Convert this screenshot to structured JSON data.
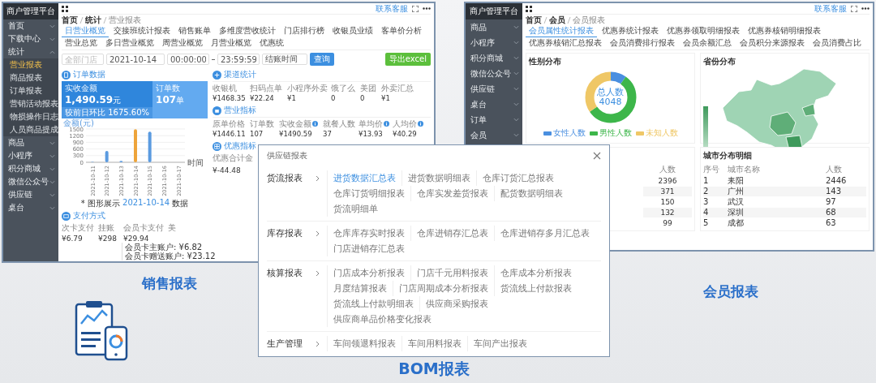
{
  "sales_screen": {
    "brand": "商户管理平台",
    "sidebar": {
      "items": [
        {
          "label": "首页",
          "expanded": false
        },
        {
          "label": "下载中心",
          "expanded": false
        },
        {
          "label": "统计",
          "expanded": true,
          "children": [
            {
              "label": "营业报表",
              "selected": true
            },
            {
              "label": "商品报表",
              "selected": false
            },
            {
              "label": "订单报表",
              "selected": false
            },
            {
              "label": "营销活动报表",
              "selected": false
            },
            {
              "label": "物损操作日志",
              "selected": false
            },
            {
              "label": "人员商品提成",
              "selected": false
            }
          ]
        },
        {
          "label": "商品",
          "expanded": false
        },
        {
          "label": "小程序",
          "expanded": false
        },
        {
          "label": "积分商城",
          "expanded": false
        },
        {
          "label": "微信公众号",
          "expanded": false
        },
        {
          "label": "供应链",
          "expanded": false
        },
        {
          "label": "桌台",
          "expanded": false
        }
      ]
    },
    "support": "联系客服",
    "breadcrumb": [
      "首页",
      "统计",
      "营业报表"
    ],
    "tabs": [
      {
        "label": "日营业概览",
        "selected": true
      },
      {
        "label": "交接班统计报表",
        "selected": false
      },
      {
        "label": "销售账单",
        "selected": false
      },
      {
        "label": "多维度营收统计",
        "selected": false
      },
      {
        "label": "门店排行榜",
        "selected": false
      },
      {
        "label": "收银员业绩",
        "selected": false
      },
      {
        "label": "客单价分析",
        "selected": false
      },
      {
        "label": "营业总览",
        "selected": false
      },
      {
        "label": "多日营业概览",
        "selected": false
      },
      {
        "label": "周营业概览",
        "selected": false
      },
      {
        "label": "月营业概览",
        "selected": false
      },
      {
        "label": "优惠统",
        "selected": false
      }
    ],
    "filters": {
      "store": {
        "placeholder": "全部门店"
      },
      "date": "2021-10-14",
      "start_time": "00:00:00",
      "end_time": "23:59:59",
      "time_type": "结账时间",
      "query_button": "查询",
      "export_button": "导出excel"
    },
    "order_data": {
      "title": "订单数据",
      "cards": [
        {
          "label": "实收金额",
          "value": "1,490.59",
          "unit": "元",
          "note": "较前日环比 1675.60%",
          "selected": true
        },
        {
          "label": "订单数",
          "value": "107",
          "unit": "单",
          "selected": false
        }
      ],
      "chart_data": {
        "type": "bar",
        "xlabel": "时间",
        "grid": true,
        "categories": [
          "2021-10-11",
          "2021-10-12",
          "2021-10-13",
          "2021-10-14",
          "2021-10-15",
          "2021-10-16",
          "2021-10-17"
        ],
        "series": [
          {
            "name": "金额(元)",
            "color": "#5b9be0",
            "values": [
              20,
              510,
              60,
              null,
              1380,
              null,
              null
            ]
          },
          {
            "name": "2021-10-14",
            "color": "#eea43a",
            "values": [
              null,
              null,
              null,
              1490,
              null,
              null,
              null
            ]
          }
        ],
        "ylim": [
          0,
          1500
        ],
        "yticks": [
          0,
          300,
          600,
          900,
          1200,
          1500
        ]
      },
      "chart_caption": {
        "prefix": "* 图形展示",
        "suffix": "数据"
      }
    },
    "payment": {
      "title": "支付方式",
      "columns": [
        "次卡支付",
        "挂账",
        "会员卡支付",
        "美"
      ],
      "values": [
        "¥6.79",
        "¥298",
        "¥29.94"
      ],
      "member_card_details": [
        "会员卡主账户: ¥6.82",
        "会员卡赠送账户: ¥23.12"
      ]
    },
    "channel_stats": {
      "title": "渠道统计",
      "columns": [
        "收银机",
        "扫码点单",
        "小程序外卖",
        "饿了么",
        "美团",
        "外卖汇总"
      ],
      "values": [
        "¥1468.35",
        "¥22.24",
        "¥1",
        "0",
        "0",
        "¥1"
      ]
    },
    "business_metrics": {
      "title": "营业指标",
      "columns": [
        {
          "label": "原单价格",
          "info": false
        },
        {
          "label": "订单数",
          "info": false
        },
        {
          "label": "实收金额",
          "info": true
        },
        {
          "label": "就餐人数",
          "info": false
        },
        {
          "label": "单均价",
          "info": true
        },
        {
          "label": "人均价",
          "info": true
        }
      ],
      "values": [
        "¥1446.11",
        "107",
        "¥1490.59",
        "37",
        "¥13.93",
        "¥40.29"
      ]
    },
    "discount_metrics": {
      "title": "优惠指标",
      "columns": [
        "优惠合计金"
      ],
      "values": [
        "¥-44.48"
      ]
    }
  },
  "sales_caption": "销售报表",
  "member_screen": {
    "brand": "商户管理平台",
    "sidebar": {
      "items": [
        {
          "label": "商品",
          "expanded": false
        },
        {
          "label": "小程序",
          "expanded": false
        },
        {
          "label": "积分商城",
          "expanded": false
        },
        {
          "label": "微信公众号",
          "expanded": false
        },
        {
          "label": "供应链",
          "expanded": false
        },
        {
          "label": "桌台",
          "expanded": false
        },
        {
          "label": "订单",
          "expanded": false
        },
        {
          "label": "会员",
          "expanded": false
        }
      ]
    },
    "support": "联系客服",
    "breadcrumb": [
      "首页",
      "会员",
      "会员报表"
    ],
    "tabs": [
      {
        "label": "会员属性统计报表",
        "selected": true
      },
      {
        "label": "优惠券统计报表",
        "selected": false
      },
      {
        "label": "优惠券领取明细报表",
        "selected": false
      },
      {
        "label": "优惠券核销明细报表",
        "selected": false
      },
      {
        "label": "优惠券核销汇总报表",
        "selected": false
      },
      {
        "label": "会员消费排行报表",
        "selected": false
      },
      {
        "label": "会员余额汇总",
        "selected": false
      },
      {
        "label": "会员积分来源报表",
        "selected": false
      },
      {
        "label": "会员消费占比",
        "selected": false
      }
    ],
    "gender": {
      "title": "性别分布",
      "center_label": "总人数",
      "total": "4048",
      "legend": [
        {
          "label": "女性人数",
          "color": "#4a8fe0"
        },
        {
          "label": "男性人数",
          "color": "#3db64a"
        },
        {
          "label": "未知人数",
          "color": "#efc766"
        }
      ]
    },
    "province": {
      "title": "省份分布"
    },
    "level_table": {
      "columns": [
        "人数"
      ],
      "rows": [
        [
          "2396"
        ],
        [
          "371"
        ],
        [
          "150"
        ],
        [
          "132"
        ],
        [
          "99"
        ]
      ]
    },
    "city_table": {
      "title": "城市分布明细",
      "columns": [
        "序号",
        "城市名称",
        "人数"
      ],
      "rows": [
        [
          "1",
          "耒阳",
          "2446"
        ],
        [
          "2",
          "广州",
          "143"
        ],
        [
          "3",
          "武汉",
          "97"
        ],
        [
          "4",
          "深圳",
          "68"
        ],
        [
          "5",
          "成都",
          "63"
        ]
      ]
    }
  },
  "member_caption": "会员报表",
  "supply_popup": {
    "title": "供应链报表",
    "groups": [
      {
        "label": "货流报表",
        "items": [
          {
            "label": "进货数据汇总表",
            "selected": true
          },
          {
            "label": "进货数据明细表",
            "selected": false
          },
          {
            "label": "仓库订货汇总报表",
            "selected": false
          },
          {
            "label": "仓库订货明细报表",
            "selected": false
          },
          {
            "label": "仓库实发差货报表",
            "selected": false
          },
          {
            "label": "配货数据明细表",
            "selected": false
          },
          {
            "label": "货流明细单",
            "selected": false
          }
        ]
      },
      {
        "label": "库存报表",
        "items": [
          {
            "label": "仓库库存实时报表",
            "selected": false
          },
          {
            "label": "仓库进销存汇总表",
            "selected": false
          },
          {
            "label": "仓库进销存多月汇总表",
            "selected": false
          },
          {
            "label": "门店进销存汇总表",
            "selected": false
          }
        ]
      },
      {
        "label": "核算报表",
        "items": [
          {
            "label": "门店成本分析报表",
            "selected": false
          },
          {
            "label": "门店千元用料报表",
            "selected": false
          },
          {
            "label": "仓库成本分析报表",
            "selected": false
          },
          {
            "label": "月度结算报表",
            "selected": false
          },
          {
            "label": "门店周期成本分析报表",
            "selected": false
          },
          {
            "label": "货流线上付款报表",
            "selected": false
          },
          {
            "label": "货流线上付款明细表",
            "selected": false
          },
          {
            "label": "供应商采购报表",
            "selected": false
          },
          {
            "label": "供应商单品价格变化报表",
            "selected": false
          }
        ]
      },
      {
        "label": "生产管理",
        "items": [
          {
            "label": "车间领退料报表",
            "selected": false
          },
          {
            "label": "车间用料报表",
            "selected": false
          },
          {
            "label": "车间产出报表",
            "selected": false
          }
        ]
      }
    ]
  },
  "bom_caption": "BOM报表"
}
